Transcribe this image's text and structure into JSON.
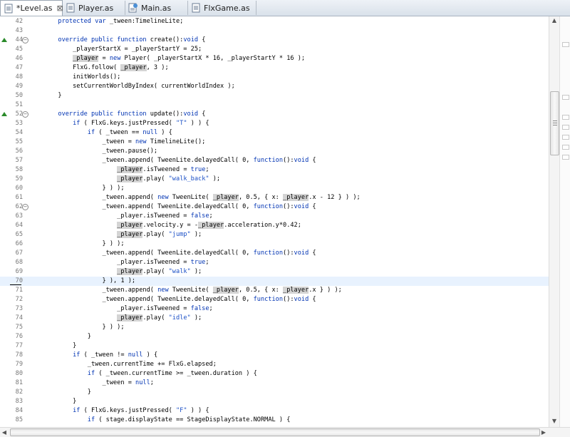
{
  "tabs": [
    {
      "label": "*Level.as",
      "active": true,
      "icon": "as-file-icon",
      "has_close": true
    },
    {
      "label": "Player.as",
      "active": false,
      "icon": "as-file-icon",
      "has_close": false
    },
    {
      "label": "Main.as",
      "active": false,
      "icon": "as-main-file-icon",
      "has_close": false
    },
    {
      "label": "FlxGame.as",
      "active": false,
      "icon": "as-file-icon",
      "has_close": false
    }
  ],
  "tab_close_symbol": "⊠",
  "editor": {
    "current_line": 70,
    "lines": [
      {
        "n": "42",
        "html": "        <span class=\"kw\">protected var</span> _tween:TimelineLite;"
      },
      {
        "n": "43",
        "html": ""
      },
      {
        "n": "44",
        "fold": true,
        "marker": true,
        "html": "        <span class=\"kw\">override public function</span> create():<span class=\"kw\">void</span> {"
      },
      {
        "n": "45",
        "html": "            _playerStartX = _playerStartY = 25;"
      },
      {
        "n": "46",
        "html": "            <span class=\"hl\">_player</span> = <span class=\"kw\">new</span> Player( _playerStartX * 16, _playerStartY * 16 );"
      },
      {
        "n": "47",
        "html": "            FlxG.follow( <span class=\"hl\">_player</span>, 3 );"
      },
      {
        "n": "48",
        "html": "            initWorlds();"
      },
      {
        "n": "49",
        "html": "            setCurrentWorldByIndex( currentWorldIndex );"
      },
      {
        "n": "50",
        "html": "        }"
      },
      {
        "n": "51",
        "html": ""
      },
      {
        "n": "52",
        "fold": true,
        "marker": true,
        "html": "        <span class=\"kw\">override public function</span> update():<span class=\"kw\">void</span> {"
      },
      {
        "n": "53",
        "html": "            <span class=\"kw\">if</span> ( FlxG.keys.justPressed( <span class=\"str\">\"T\"</span> ) ) {"
      },
      {
        "n": "54",
        "html": "                <span class=\"kw\">if</span> ( _tween == <span class=\"kw\">null</span> ) {"
      },
      {
        "n": "55",
        "html": "                    _tween = <span class=\"kw\">new</span> TimelineLite();"
      },
      {
        "n": "56",
        "html": "                    _tween.pause();"
      },
      {
        "n": "57",
        "html": "                    _tween.append( TweenLite.delayedCall( 0, <span class=\"kw\">function</span>():<span class=\"kw\">void</span> {"
      },
      {
        "n": "58",
        "html": "                        <span class=\"hl\">_player</span>.isTweened = <span class=\"kw\">true</span>;"
      },
      {
        "n": "59",
        "html": "                        <span class=\"hl\">_player</span>.play( <span class=\"str\">\"walk_back\"</span> );"
      },
      {
        "n": "60",
        "html": "                    } ) );"
      },
      {
        "n": "61",
        "html": "                    _tween.append( <span class=\"kw\">new</span> TweenLite( <span class=\"hl\">_player</span>, 0.5, { x: <span class=\"hl\">_player</span>.x - 12 } ) );"
      },
      {
        "n": "62",
        "fold": true,
        "html": "                    _tween.append( TweenLite.delayedCall( 0, <span class=\"kw\">function</span>():<span class=\"kw\">void</span> {"
      },
      {
        "n": "63",
        "html": "                        _player.isTweened = <span class=\"kw\">false</span>;"
      },
      {
        "n": "64",
        "html": "                        <span class=\"hl\">_player</span>.velocity.y = -<span class=\"hl\">_player</span>.acceleration.y*0.42;"
      },
      {
        "n": "65",
        "html": "                        <span class=\"hl\">_player</span>.play( <span class=\"str\">\"jump\"</span> );"
      },
      {
        "n": "66",
        "html": "                    } ) );"
      },
      {
        "n": "67",
        "html": "                    _tween.append( TweenLite.delayedCall( 0, <span class=\"kw\">function</span>():<span class=\"kw\">void</span> {"
      },
      {
        "n": "68",
        "html": "                        _player.isTweened = <span class=\"kw\">true</span>;"
      },
      {
        "n": "69",
        "html": "                        <span class=\"hl\">_player</span>.play( <span class=\"str\">\"walk\"</span> );"
      },
      {
        "n": "70",
        "html": "                    } ), 1 );"
      },
      {
        "n": "71",
        "html": "                    _tween.append( <span class=\"kw\">new</span> TweenLite( <span class=\"hl\">_player</span>, 0.5, { x: <span class=\"hl\">_player</span>.x } ) );"
      },
      {
        "n": "72",
        "html": "                    _tween.append( TweenLite.delayedCall( 0, <span class=\"kw\">function</span>():<span class=\"kw\">void</span> {"
      },
      {
        "n": "73",
        "html": "                        _player.isTweened = <span class=\"kw\">false</span>;"
      },
      {
        "n": "74",
        "html": "                        <span class=\"hl\">_player</span>.play( <span class=\"str\">\"idle\"</span> );"
      },
      {
        "n": "75",
        "html": "                    } ) );"
      },
      {
        "n": "76",
        "html": "                }"
      },
      {
        "n": "77",
        "html": "            }"
      },
      {
        "n": "78",
        "html": "            <span class=\"kw\">if</span> ( _tween != <span class=\"kw\">null</span> ) {"
      },
      {
        "n": "79",
        "html": "                _tween.currentTime += FlxG.elapsed;"
      },
      {
        "n": "80",
        "html": "                <span class=\"kw\">if</span> ( _tween.currentTime &gt;= _tween.duration ) {"
      },
      {
        "n": "81",
        "html": "                    _tween = <span class=\"kw\">null</span>;"
      },
      {
        "n": "82",
        "html": "                }"
      },
      {
        "n": "83",
        "html": "            }"
      },
      {
        "n": "84",
        "html": "            <span class=\"kw\">if</span> ( FlxG.keys.justPressed( <span class=\"str\">\"F\"</span> ) ) {"
      },
      {
        "n": "85",
        "html": "                <span class=\"kw\">if</span> ( stage.displayState == StageDisplayState.NORMAL ) {"
      }
    ]
  },
  "scrollbar": {
    "up_arrow": "▲",
    "down_arrow": "▼",
    "left_arrow": "◀",
    "right_arrow": "▶"
  },
  "colors": {
    "keyword": "#0033b3",
    "string": "#1d51c7",
    "occurrence_highlight": "#d4d4d4",
    "current_line": "#e8f2fe"
  }
}
